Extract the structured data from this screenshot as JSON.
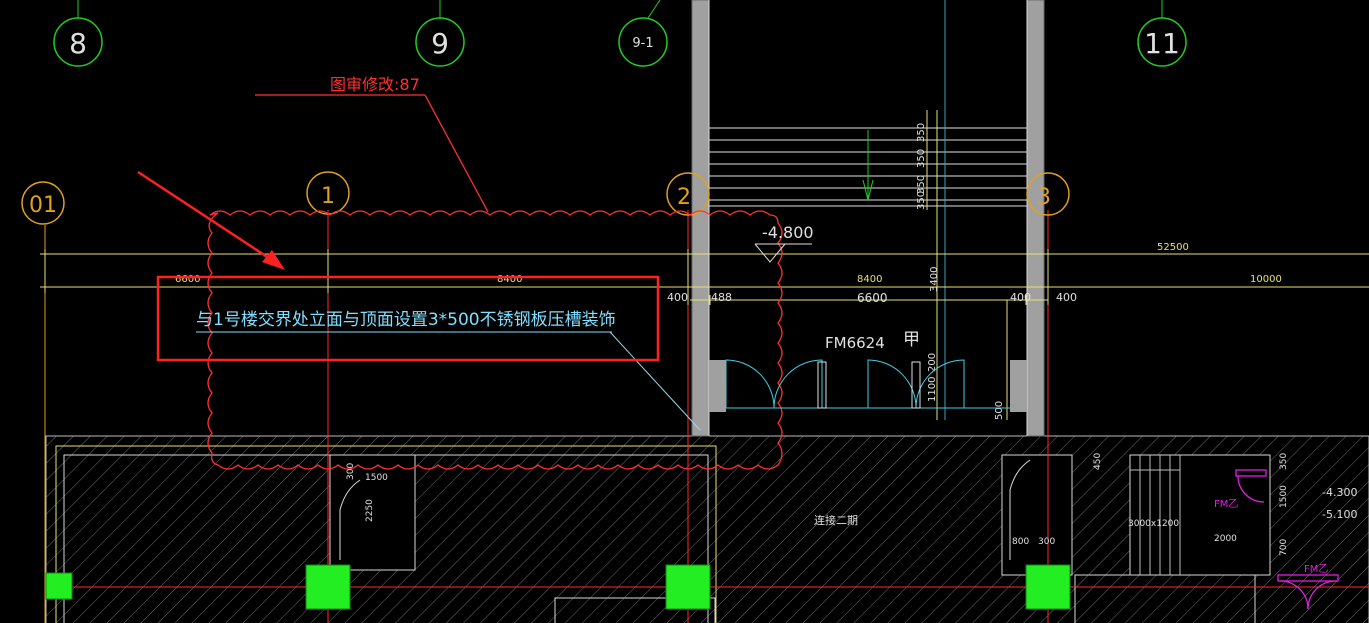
{
  "colors": {
    "background": "#000000",
    "grid_axis": "#ff2a2a",
    "axis_bubble_green": "#22cc22",
    "axis_bubble_orange": "#e0a020",
    "dimension": "#e8e070",
    "wall": "#a0a0a0",
    "door": "#40d0e0",
    "annotation": "#ff3030",
    "note_text": "#7fdfff",
    "column_fill": "#22ee22",
    "hatch": "#7a7a7a",
    "magenta": "#e020e0",
    "white_text": "#ffffff"
  },
  "axis_labels": {
    "a8": "8",
    "a9": "9",
    "a9_1": "9-1",
    "a11": "11",
    "a01": "01",
    "a1": "1",
    "a2": "2",
    "a3": "3"
  },
  "revision_tag": "图审修改:87",
  "elevation_label": "-4.800",
  "dimensions": {
    "d6600a": "6600",
    "d8400a": "8400",
    "d8400b": "8400",
    "d52500": "52500",
    "d10000": "10000",
    "d400a": "400",
    "d488": "488",
    "d6600b": "6600",
    "d400b": "400",
    "d400c": "400",
    "d350a": "350",
    "d350b": "350",
    "d350c": "350",
    "d350d": "350",
    "d3400": "3400",
    "d200": "200",
    "d1100": "1100",
    "d500": "500"
  },
  "door_label": "FM6624",
  "door_class": "甲",
  "note_text": "与1号楼交界处立面与顶面设置3*500不锈钢板压槽装饰",
  "lower_plan": {
    "label_link": "连接二期",
    "d300a": "300",
    "d1500": "1500",
    "d2250": "2250",
    "d800": "800",
    "d300b": "300",
    "opening": "3000x1200",
    "d2000": "2000",
    "d450": "450",
    "d350": "350",
    "d1500b": "1500",
    "d700": "700",
    "fm1": "FM乙",
    "fm2": "FM乙",
    "elev1": "-4.300",
    "elev2": "-5.100"
  }
}
